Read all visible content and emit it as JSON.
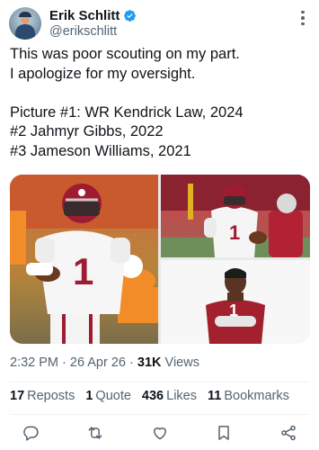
{
  "author": {
    "display_name": "Erik Schlitt",
    "handle": "@erikschlitt",
    "verified": true
  },
  "tweet": {
    "lines": [
      "This was poor scouting on my part.",
      "I apologize for my oversight.",
      "",
      "Picture #1: WR Kendrick Law, 2024",
      "#2 Jahmyr Gibbs, 2022",
      "#3 Jameson Williams, 2021"
    ]
  },
  "media": {
    "photos": [
      {
        "description": "Alabama player number 1 carrying ball versus Tennessee"
      },
      {
        "description": "Alabama player number 1 running with ball"
      },
      {
        "description": "Alabama player number 1 posing with arms crossed"
      }
    ]
  },
  "meta": {
    "time": "2:32 PM",
    "separator": "·",
    "date": "26 Apr 26",
    "views_count": "31K",
    "views_label": "Views"
  },
  "stats": {
    "reposts_count": "17",
    "reposts_label": "Reposts",
    "quotes_count": "1",
    "quotes_label": "Quote",
    "likes_count": "436",
    "likes_label": "Likes",
    "bookmarks_count": "11",
    "bookmarks_label": "Bookmarks"
  },
  "colors": {
    "verified_blue": "#1d9bf0",
    "text_primary": "#0f1419",
    "text_secondary": "#536471",
    "alabama_crimson": "#9e1b32"
  },
  "icons": [
    "reply-icon",
    "repost-icon",
    "like-icon",
    "bookmark-icon",
    "share-icon",
    "more-icon",
    "verified-icon"
  ]
}
